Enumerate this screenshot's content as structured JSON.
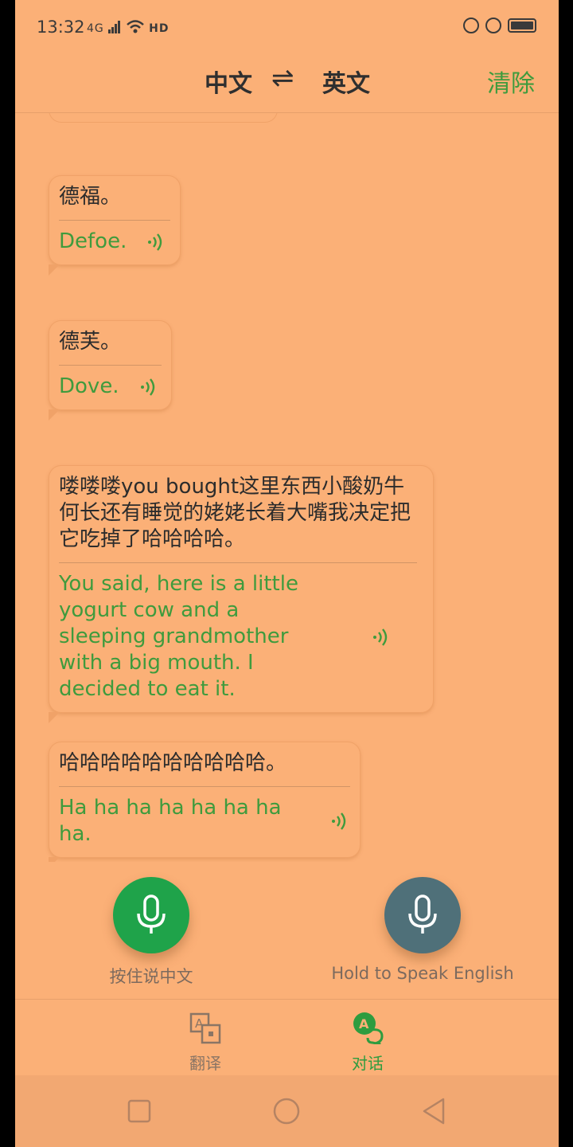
{
  "status_bar": {
    "time": "13:32",
    "signal_text": "4G",
    "hd_text": "HD"
  },
  "header": {
    "source_lang": "中文",
    "swap_symbol": "⇌",
    "target_lang": "英文",
    "clear_label": "清除"
  },
  "messages": [
    {
      "source": "德福。",
      "translation": "Defoe."
    },
    {
      "source": "德芙。",
      "translation": "Dove."
    },
    {
      "source": "喽喽喽you bought这里东西小酸奶牛何长还有睡觉的姥姥长着大嘴我决定把它吃掉了哈哈哈哈。",
      "translation": "You said, here is a little yogurt cow and a sleeping grandmother with a big mouth. I decided to eat it."
    },
    {
      "source": "哈哈哈哈哈哈哈哈哈哈。",
      "translation": "Ha ha ha ha ha ha ha ha."
    }
  ],
  "controls": {
    "speak_chinese_label": "按住说中文",
    "speak_english_label": "Hold to Speak English"
  },
  "tabs": [
    {
      "label": "翻译",
      "icon": "translate-icon",
      "active": false
    },
    {
      "label": "对话",
      "icon": "dialog-icon",
      "active": true
    }
  ],
  "colors": {
    "background": "#fbb077",
    "accent_green": "#3f9b3d",
    "mic_chinese": "#1fa34a",
    "mic_english": "#4f7079"
  }
}
